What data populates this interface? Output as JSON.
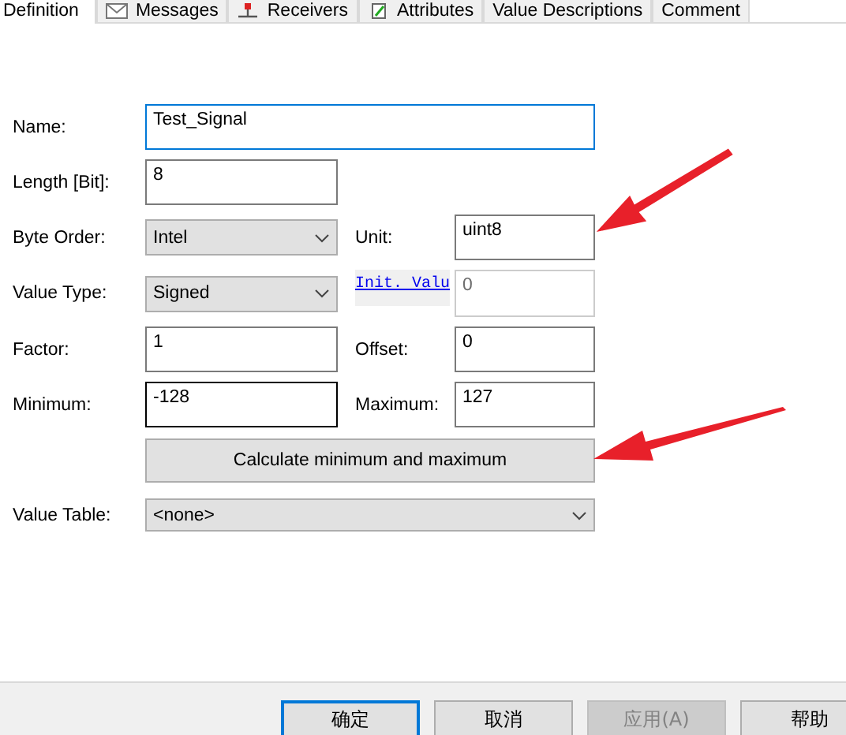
{
  "tabs": [
    {
      "label": "Definition",
      "selected": true
    },
    {
      "label": "Messages",
      "selected": false
    },
    {
      "label": "Receivers",
      "selected": false
    },
    {
      "label": "Attributes",
      "selected": false
    },
    {
      "label": "Value Descriptions",
      "selected": false
    },
    {
      "label": "Comment",
      "selected": false
    }
  ],
  "rows": [
    {
      "label": "Name:",
      "control": {
        "kind": "wide_text",
        "value": "Test_Signal",
        "focused": true,
        "hovered": false
      }
    },
    {
      "label": "Length [Bit]:",
      "control": {
        "kind": "text",
        "value": "8",
        "focused": false,
        "hovered": false
      }
    },
    {
      "label": "Byte Order:",
      "control": {
        "kind": "select",
        "value": "Intel"
      },
      "right": {
        "label": "Unit:",
        "link": false,
        "control": {
          "value": "uint8",
          "disabled": false
        }
      }
    },
    {
      "label": "Value Type:",
      "control": {
        "kind": "select",
        "value": "Signed"
      },
      "right": {
        "label": "Init. Valu",
        "link": true,
        "control": {
          "value": "0",
          "disabled": true
        }
      }
    },
    {
      "label": "Factor:",
      "control": {
        "kind": "text",
        "value": "1",
        "focused": false,
        "hovered": false
      },
      "right": {
        "label": "Offset:",
        "link": false,
        "control": {
          "value": "0",
          "disabled": false
        }
      }
    },
    {
      "label": "Minimum:",
      "control": {
        "kind": "text",
        "value": "-128",
        "focused": false,
        "hovered": true
      },
      "right": {
        "label": "Maximum:",
        "link": false,
        "control": {
          "value": "127",
          "disabled": false
        }
      }
    },
    {
      "control": {
        "kind": "button",
        "value": "Calculate minimum and maximum"
      }
    },
    {
      "label": "Value Table:",
      "control": {
        "kind": "wide_select",
        "value": "<none>"
      }
    }
  ],
  "buttons": [
    {
      "label": "确定",
      "default": true,
      "disabled": false
    },
    {
      "label": "取消",
      "default": false,
      "disabled": false
    },
    {
      "label": "应用(A)",
      "default": false,
      "disabled": true
    },
    {
      "label": "帮助",
      "default": false,
      "disabled": false
    }
  ]
}
